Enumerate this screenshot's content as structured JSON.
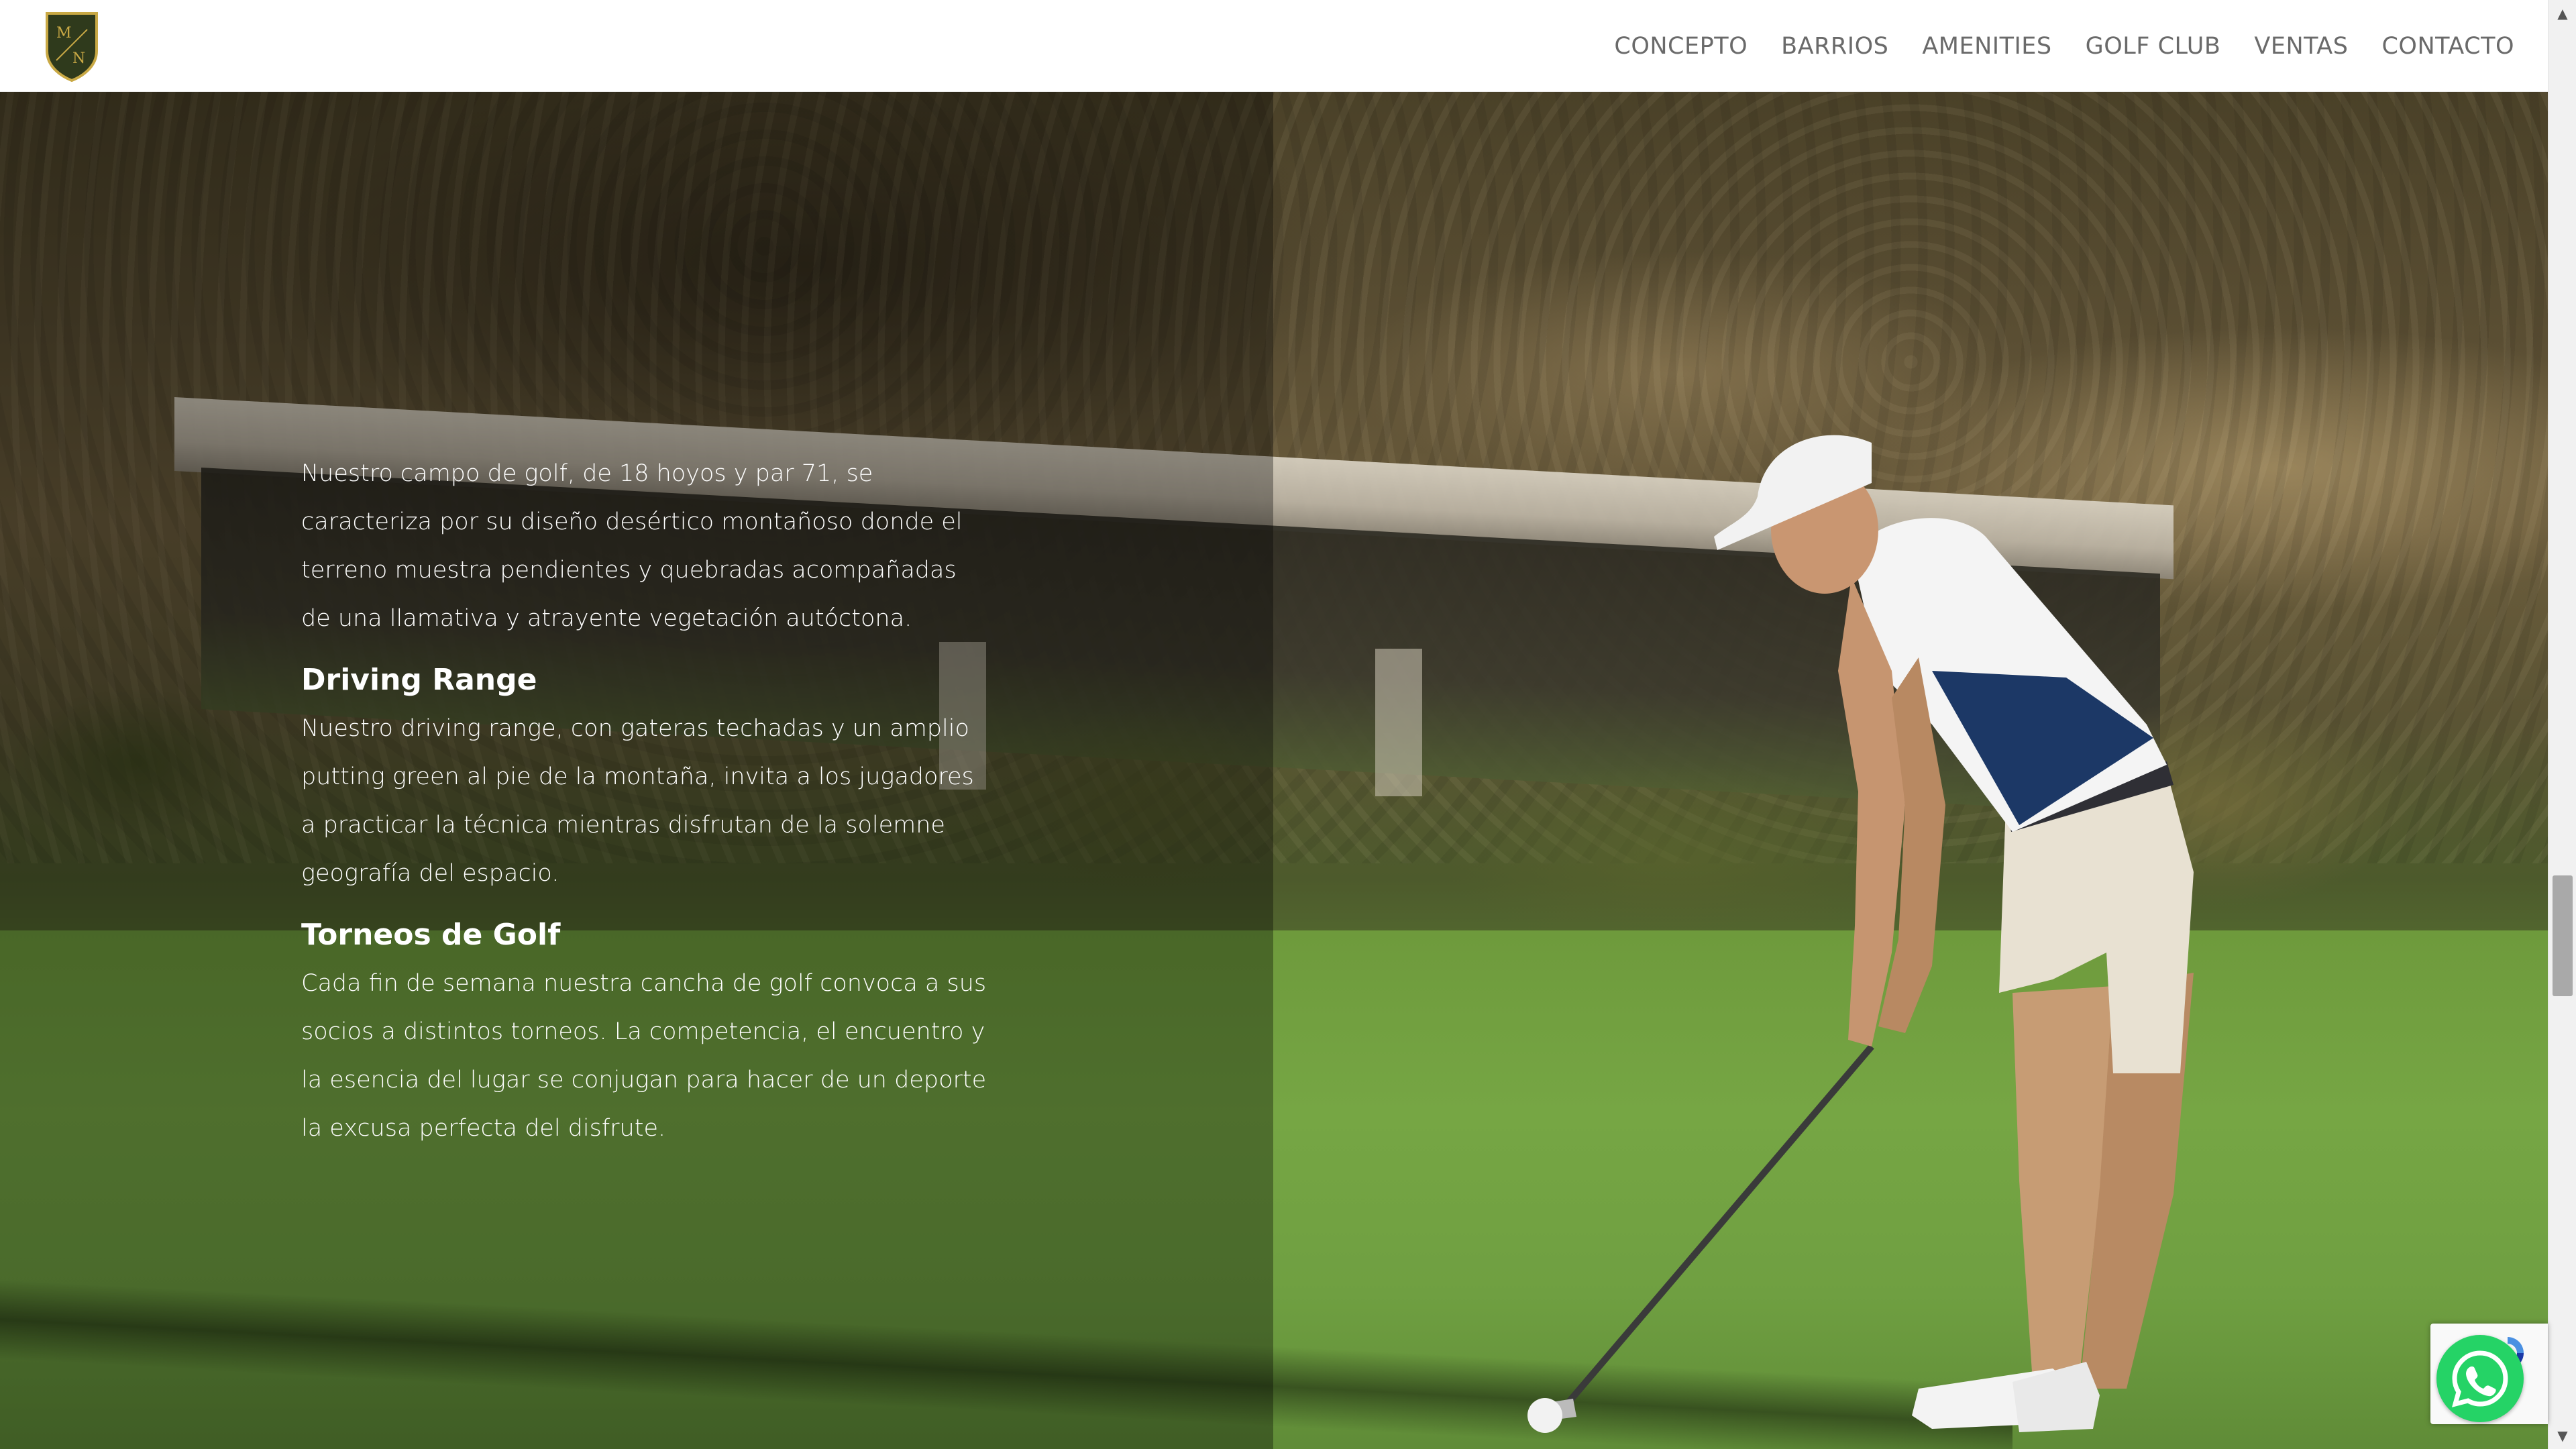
{
  "header": {
    "logo_letters": "M N",
    "nav": [
      {
        "label": "CONCEPTO"
      },
      {
        "label": "BARRIOS"
      },
      {
        "label": "AMENITIES"
      },
      {
        "label": "GOLF CLUB"
      },
      {
        "label": "VENTAS"
      },
      {
        "label": "CONTACTO"
      }
    ]
  },
  "content": {
    "intro": "Nuestro campo de golf, de 18 hoyos y par 71, se caracteriza por su diseño desértico montañoso donde el terreno muestra pendientes y quebradas acompañadas de una llamativa y atrayente vegetación autóctona.",
    "sections": [
      {
        "title": "Driving Range",
        "text": "Nuestro driving range, con gateras techadas y un amplio putting green al pie de la montaña, invita a los jugadores a practicar la técnica mientras disfrutan de la solemne geografía del espacio."
      },
      {
        "title": "Torneos de Golf",
        "text": "Cada fin de semana nuestra cancha de golf convoca a sus socios a distintos torneos. La competencia, el encuentro y la esencia del lugar se conjugan para hacer de un deporte la excusa perfecta del disfrute."
      }
    ]
  },
  "widgets": {
    "whatsapp_icon": "whatsapp-icon",
    "whatsapp_color": "#25d366",
    "recaptcha_icon": "recaptcha-icon"
  },
  "colors": {
    "nav_text": "#6a6a6a",
    "logo_green": "#2f3a1c",
    "logo_gold": "#c9a945"
  }
}
